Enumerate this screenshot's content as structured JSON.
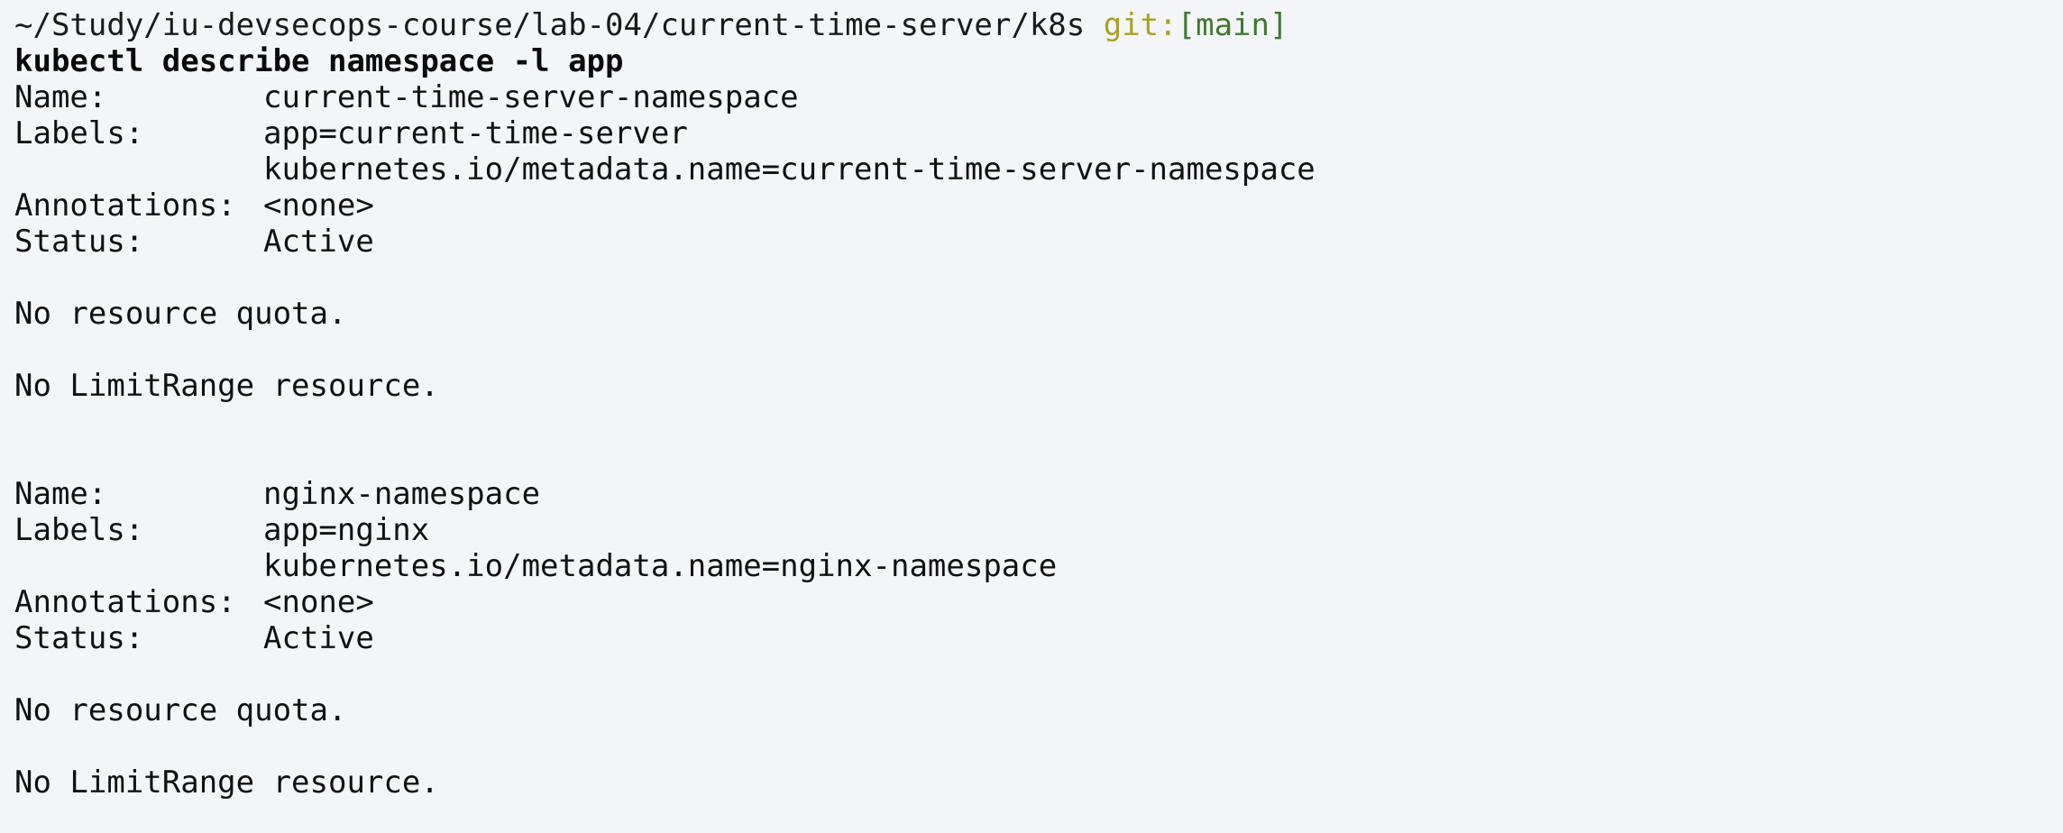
{
  "prompt": {
    "path": "~/Study/iu-devsecops-course/lab-04/current-time-server/k8s",
    "git_label": "git:",
    "git_branch": "[main]"
  },
  "command": "kubectl describe namespace -l app",
  "namespaces": [
    {
      "name_key": "Name:",
      "name": "current-time-server-namespace",
      "labels_key": "Labels:",
      "label_1": "app=current-time-server",
      "label_2": "kubernetes.io/metadata.name=current-time-server-namespace",
      "annotations_key": "Annotations:",
      "annotations": "<none>",
      "status_key": "Status:",
      "status": "Active",
      "quota": "No resource quota.",
      "limit_range": "No LimitRange resource."
    },
    {
      "name_key": "Name:",
      "name": "nginx-namespace",
      "labels_key": "Labels:",
      "label_1": "app=nginx",
      "label_2": "kubernetes.io/metadata.name=nginx-namespace",
      "annotations_key": "Annotations:",
      "annotations": "<none>",
      "status_key": "Status:",
      "status": "Active",
      "quota": "No resource quota.",
      "limit_range": "No LimitRange resource."
    }
  ]
}
